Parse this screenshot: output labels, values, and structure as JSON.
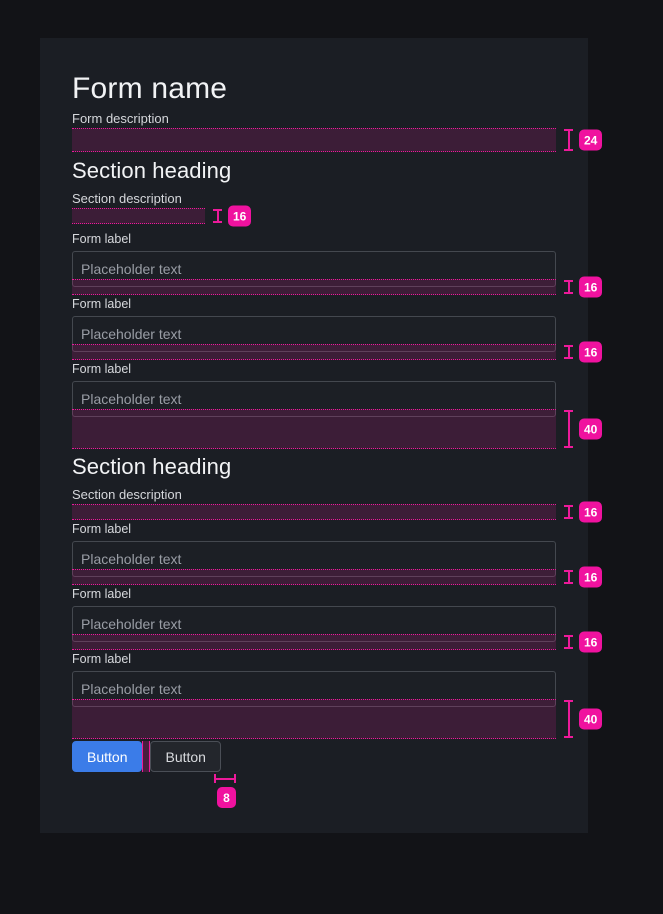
{
  "page": {
    "background": "#121317",
    "card_background": "#1b1e24",
    "accent_magenta": "#ec1a9a",
    "badge_color": "#f0129f",
    "primary_button_color": "#3b7ce8"
  },
  "form": {
    "title": "Form name",
    "description": "Form description",
    "description_spacing": "24"
  },
  "sections": [
    {
      "heading": "Section heading",
      "description": "Section description",
      "description_spacing": "16",
      "description_spacer_full_width": false,
      "fields": [
        {
          "label": "Form label",
          "placeholder": "Placeholder text",
          "spacing": "16",
          "spacer_height": 16
        },
        {
          "label": "Form label",
          "placeholder": "Placeholder text",
          "spacing": "16",
          "spacer_height": 16
        },
        {
          "label": "Form label",
          "placeholder": "Placeholder text",
          "spacing": "40",
          "spacer_height": 40
        }
      ]
    },
    {
      "heading": "Section heading",
      "description": "Section description",
      "description_spacing": "16",
      "description_spacer_full_width": true,
      "fields": [
        {
          "label": "Form label",
          "placeholder": "Placeholder text",
          "spacing": "16",
          "spacer_height": 16
        },
        {
          "label": "Form label",
          "placeholder": "Placeholder text",
          "spacing": "16",
          "spacer_height": 16
        },
        {
          "label": "Form label",
          "placeholder": "Placeholder text",
          "spacing": "40",
          "spacer_height": 40
        }
      ]
    }
  ],
  "actions": {
    "primary_label": "Button",
    "secondary_label": "Button",
    "gap_spacing": "8"
  }
}
